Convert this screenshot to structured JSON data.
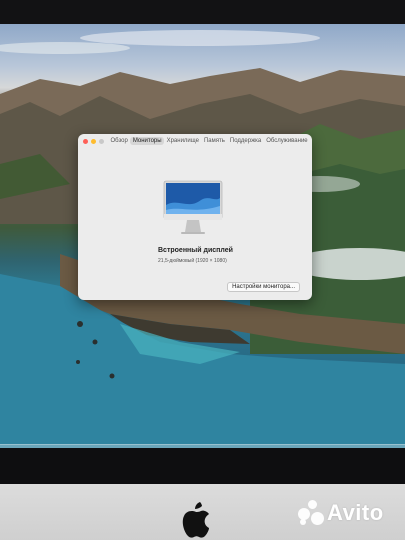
{
  "window": {
    "tabs": [
      {
        "label": "Обзор",
        "active": false
      },
      {
        "label": "Мониторы",
        "active": true
      },
      {
        "label": "Хранилище",
        "active": false
      },
      {
        "label": "Память",
        "active": false
      },
      {
        "label": "Поддержка",
        "active": false
      },
      {
        "label": "Обслуживание",
        "active": false
      }
    ],
    "display_name": "Встроенный дисплей",
    "display_spec": "21,5-дюймовый (1920 × 1080)",
    "settings_button": "Настройки мониторa..."
  },
  "dock": {
    "icons": [
      "notes-icon",
      "reminders-icon",
      "photos-icon",
      "messages-icon",
      "facetime-icon",
      "pages-icon",
      "numbers-icon",
      "keynote-icon",
      "music-icon",
      "podcasts-icon",
      "appletv-icon",
      "books-icon",
      "appstore-icon",
      "launchpad-icon",
      "system-preferences-icon",
      "trash-icon"
    ]
  },
  "watermark": {
    "text": "Avito"
  },
  "colors": {
    "accent_red": "#fe5f57",
    "accent_yellow": "#febc2e"
  }
}
